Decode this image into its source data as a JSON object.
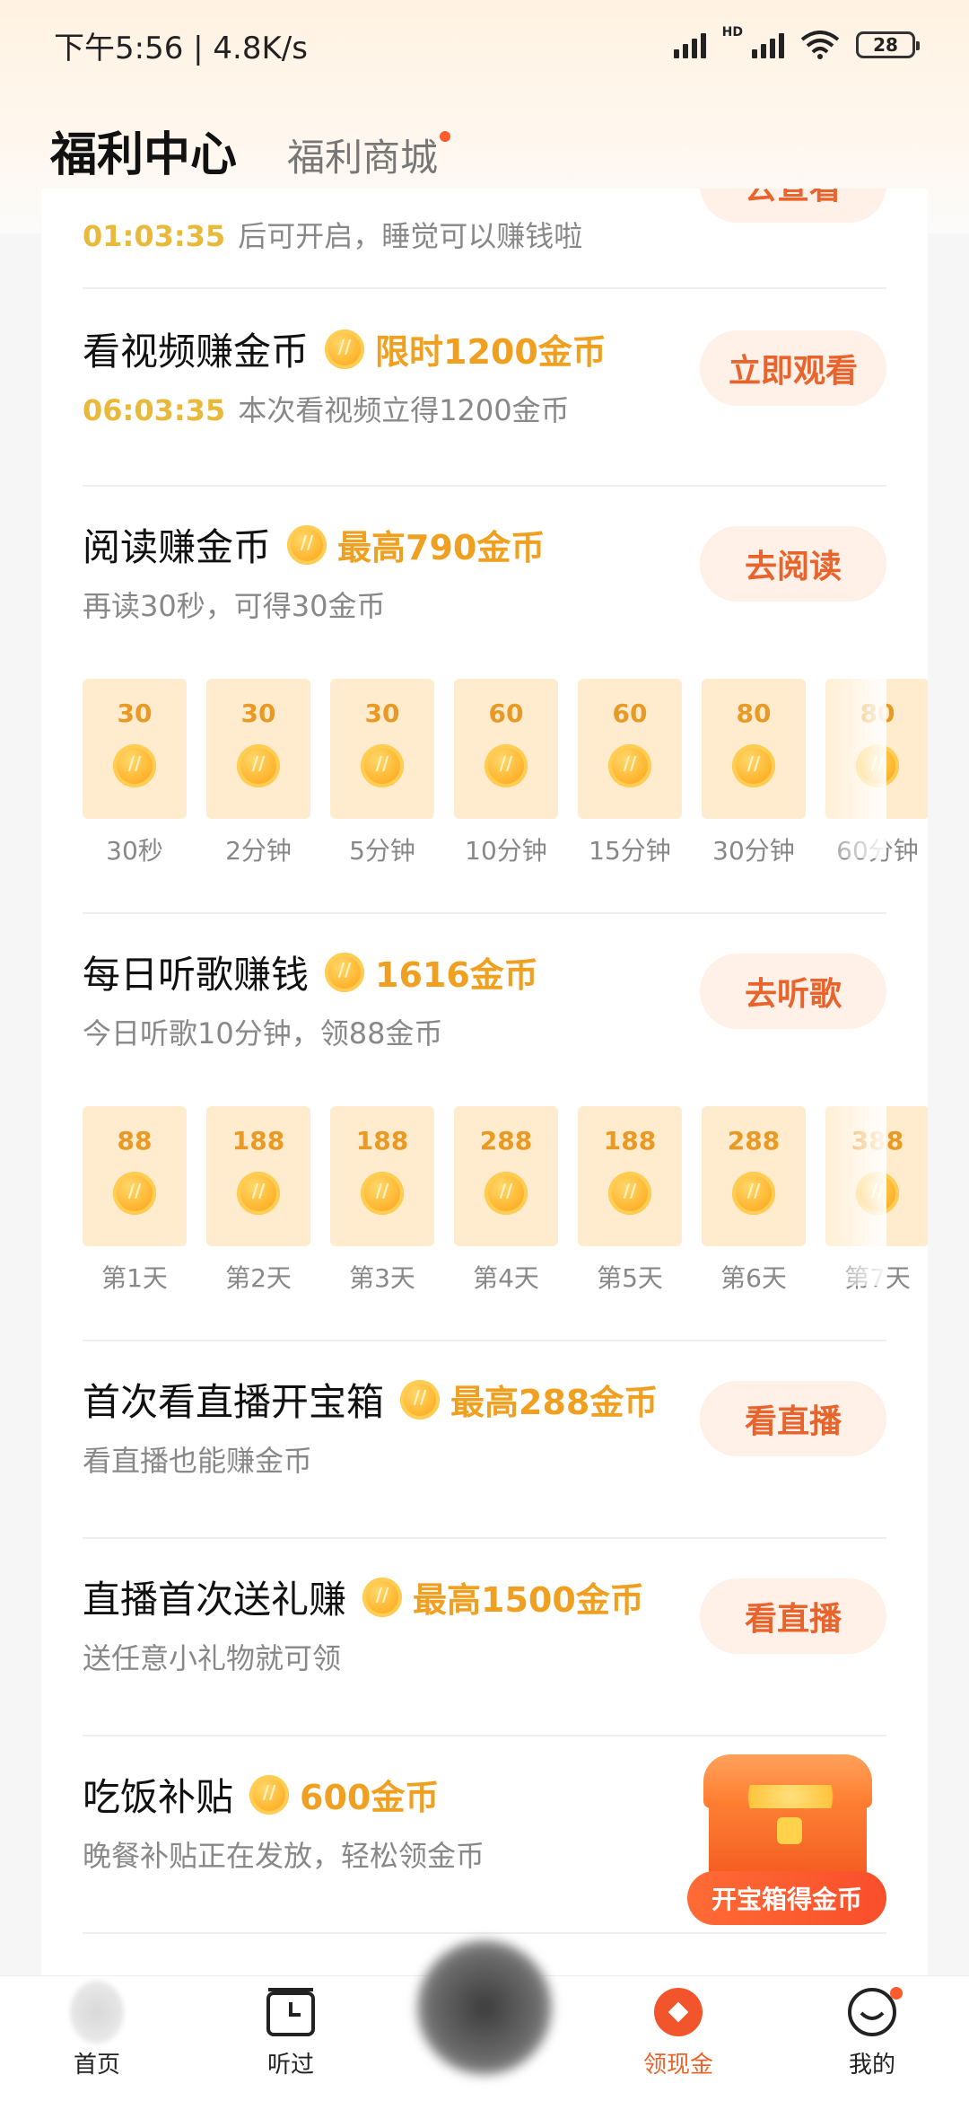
{
  "status_bar": {
    "time_speed": "下午5:56 | 4.8K/s",
    "hd_label": "HD",
    "battery": "28"
  },
  "header": {
    "title": "福利中心",
    "shop_tab": "福利商城"
  },
  "tasks": {
    "sleep": {
      "timer": "01:03:35",
      "desc": "后可开启，睡觉可以赚钱啦",
      "button": "去查看"
    },
    "video": {
      "title": "看视频赚金币",
      "reward": "限时1200金币",
      "timer": "06:03:35",
      "desc": "本次看视频立得1200金币",
      "button": "立即观看"
    },
    "read": {
      "title": "阅读赚金币",
      "reward": "最高790金币",
      "desc": "再读30秒，可得30金币",
      "button": "去阅读",
      "tiles": [
        {
          "value": "30",
          "label": "30秒"
        },
        {
          "value": "30",
          "label": "2分钟"
        },
        {
          "value": "30",
          "label": "5分钟"
        },
        {
          "value": "60",
          "label": "10分钟"
        },
        {
          "value": "60",
          "label": "15分钟"
        },
        {
          "value": "80",
          "label": "30分钟"
        },
        {
          "value": "80",
          "label": "60分钟"
        }
      ]
    },
    "music": {
      "title": "每日听歌赚钱",
      "reward": "1616金币",
      "desc": "今日听歌10分钟，领88金币",
      "button": "去听歌",
      "tiles": [
        {
          "value": "88",
          "label": "第1天"
        },
        {
          "value": "188",
          "label": "第2天"
        },
        {
          "value": "188",
          "label": "第3天"
        },
        {
          "value": "288",
          "label": "第4天"
        },
        {
          "value": "188",
          "label": "第5天"
        },
        {
          "value": "288",
          "label": "第6天"
        },
        {
          "value": "388",
          "label": "第7天"
        }
      ]
    },
    "live_box": {
      "title": "首次看直播开宝箱",
      "reward": "最高288金币",
      "desc": "看直播也能赚金币",
      "button": "看直播"
    },
    "live_gift": {
      "title": "直播首次送礼赚",
      "reward": "最高1500金币",
      "desc": "送任意小礼物就可领",
      "button": "看直播"
    },
    "meal": {
      "title": "吃饭补贴",
      "reward": "600金币",
      "desc": "晚餐补贴正在发放，轻松领金币",
      "button": "开宝箱得金币"
    }
  },
  "nav": {
    "home": "首页",
    "history": "听过",
    "cash": "领现金",
    "mine": "我的"
  },
  "colors": {
    "accent": "#e8642c",
    "reward": "#f0a020",
    "timer": "#e8b93a"
  }
}
